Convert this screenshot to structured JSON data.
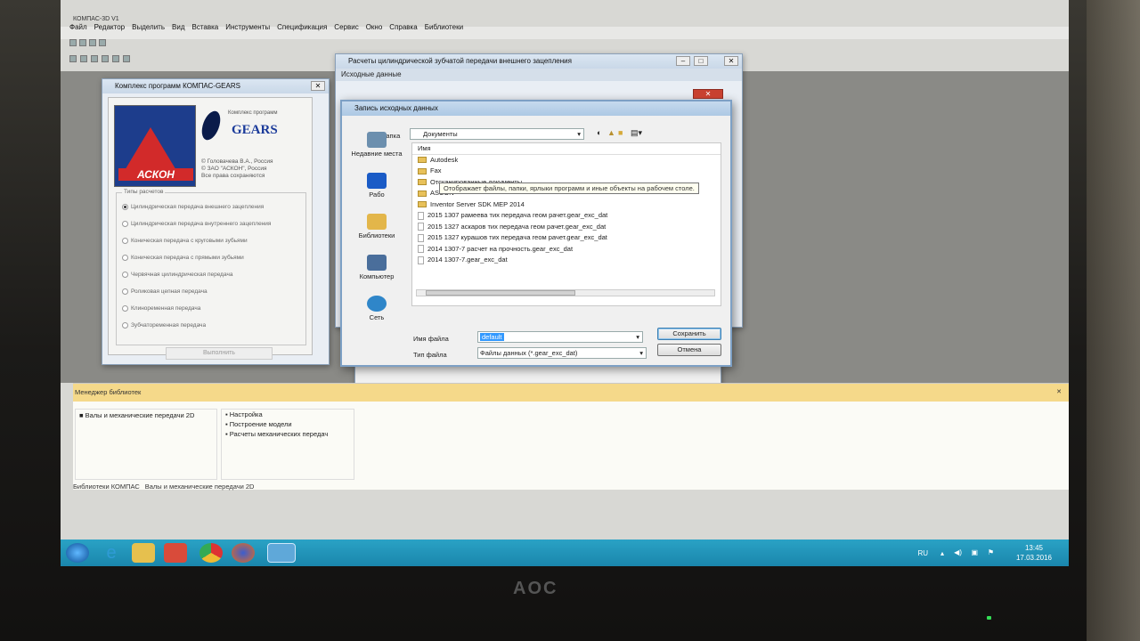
{
  "app": {
    "title": "КОМПАС-3D V1",
    "menu": [
      "Файл",
      "Редактор",
      "Выделить",
      "Вид",
      "Вставка",
      "Инструменты",
      "Спецификация",
      "Сервис",
      "Окно",
      "Справка",
      "Библиотеки"
    ]
  },
  "gears_window": {
    "title": "Комплекс программ КОМПАС-GEARS",
    "logo_text": "АСКОН",
    "gears_caption": "Комплекс программ",
    "gears_word": "GEARS",
    "copyright_lines": [
      "© Головачева В.А., Россия",
      "© ЗАО \"АСКОН\", Россия",
      "Все права сохраняются"
    ],
    "group_label": "Типы расчетов",
    "options": [
      "Цилиндрическая передача внешнего зацепления",
      "Цилиндрическая передача внутреннего зацепления",
      "Коническая передача с круговыми зубьями",
      "Коническая передача с прямыми зубьями",
      "Червячная цилиндрическая передача",
      "Роликовая цепная передача",
      "Клиноременная передача",
      "Зубчатоременная передача"
    ],
    "execute_label": "Выполнить"
  },
  "calc_window": {
    "title": "Расчеты цилиндрической зубчатой передачи внешнего зацепления",
    "subtitle": "Исходные данные"
  },
  "save_dialog": {
    "title": "Запись исходных данных",
    "folder_label": "Папка",
    "folder_value": "Документы",
    "column_name": "Имя",
    "places": [
      "Недавние места",
      "Рабо",
      "Библиотеки",
      "Компьютер",
      "Сеть"
    ],
    "folders": [
      "Autodesk",
      "Fax",
      "Отсканированные документы",
      "ASCON",
      "Inventor Server SDK MEP 2014"
    ],
    "files": [
      "2015 1307 рамеева тих передача геом рачет.gear_exc_dat",
      "2015 1327 аскаров тих передача геом рачет.gear_exc_dat",
      "2015 1327 курашов тих передача геом рачет.gear_exc_dat",
      "2014 1307-7 расчет на прочность.gear_exc_dat",
      "2014 1307-7.gear_exc_dat"
    ],
    "tooltip": "Отображает файлы, папки, ярлыки программ и иные объекты на рабочем столе.",
    "filename_label": "Имя файла",
    "filename_value": "default",
    "filetype_label": "Тип файла",
    "filetype_value": "Файлы данных (*.gear_exc_dat)",
    "save_label": "Сохранить",
    "cancel_label": "Отмена"
  },
  "library_manager": {
    "title": "Менеджер библиотек",
    "left_items": [
      "Валы и механические передачи 2D"
    ],
    "right_items": [
      "Настройка",
      "Построение модели",
      "Расчеты механических передач"
    ],
    "status_tabs": [
      "Библиотеки КОМПАС",
      "Валы и механические передачи 2D"
    ]
  },
  "taskbar": {
    "lang": "RU",
    "time": "13:45",
    "date": "17.03.2016"
  },
  "monitor": {
    "brand": "AOC"
  }
}
